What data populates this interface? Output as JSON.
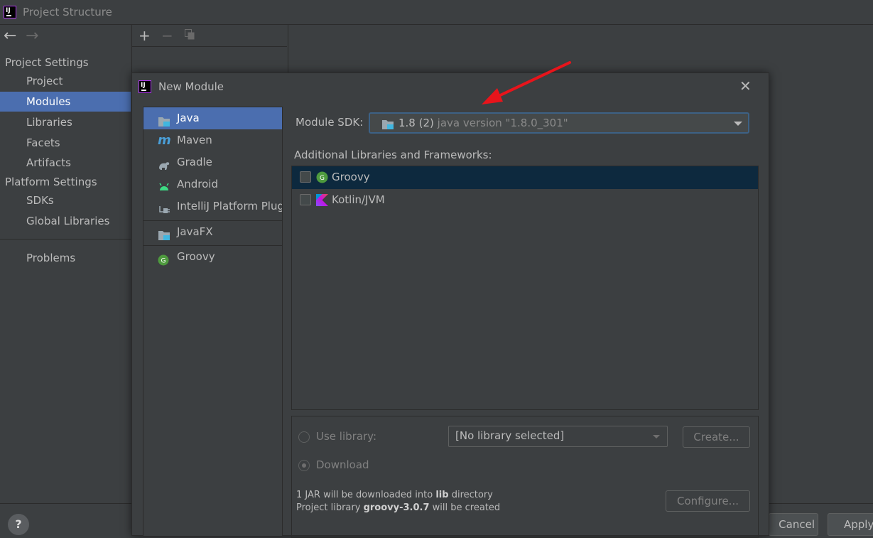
{
  "window": {
    "title": "Project Structure"
  },
  "sidebar": {
    "section_project": "Project Settings",
    "items_project": [
      {
        "label": "Project",
        "selected": false
      },
      {
        "label": "Modules",
        "selected": true
      },
      {
        "label": "Libraries",
        "selected": false
      },
      {
        "label": "Facets",
        "selected": false
      },
      {
        "label": "Artifacts",
        "selected": false
      }
    ],
    "section_platform": "Platform Settings",
    "items_platform": [
      {
        "label": "SDKs"
      },
      {
        "label": "Global Libraries"
      }
    ],
    "problems": "Problems"
  },
  "help_label": "?",
  "bottom_buttons": {
    "cancel": "Cancel",
    "apply": "Apply"
  },
  "dialog": {
    "title": "New Module",
    "module_types": [
      {
        "label": "Java",
        "icon": "folder-icon",
        "selected": true
      },
      {
        "label": "Maven",
        "icon": "maven-icon"
      },
      {
        "label": "Gradle",
        "icon": "gradle-icon"
      },
      {
        "label": "Android",
        "icon": "android-icon"
      },
      {
        "label": "IntelliJ Platform Plugin",
        "icon": "plugin-icon"
      },
      {
        "label": "JavaFX",
        "icon": "folder-icon"
      },
      {
        "label": "Groovy",
        "icon": "groovy-icon"
      }
    ],
    "sdk": {
      "label": "Module SDK:",
      "value": "1.8 (2)",
      "detail": "java version \"1.8.0_301\""
    },
    "libraries_label": "Additional Libraries and Frameworks:",
    "libraries": [
      {
        "label": "Groovy",
        "checked": false,
        "selected": true
      },
      {
        "label": "Kotlin/JVM",
        "checked": false,
        "selected": false
      }
    ],
    "use_library_label": "Use library:",
    "library_combo_value": "[No library selected]",
    "create_button": "Create...",
    "download_label": "Download",
    "note_line1_a": "1 JAR will be downloaded into",
    "note_line1_b": "lib",
    "note_line1_c": "directory",
    "note_line2_a": "Project library",
    "note_line2_b": "groovy-3.0.7",
    "note_line2_c": "will be created",
    "configure_button": "Configure..."
  },
  "colors": {
    "background": "#3c3f41",
    "selection": "#4b6eaf",
    "list_selection": "#0d293e",
    "annotation_arrow": "#e8141b"
  }
}
